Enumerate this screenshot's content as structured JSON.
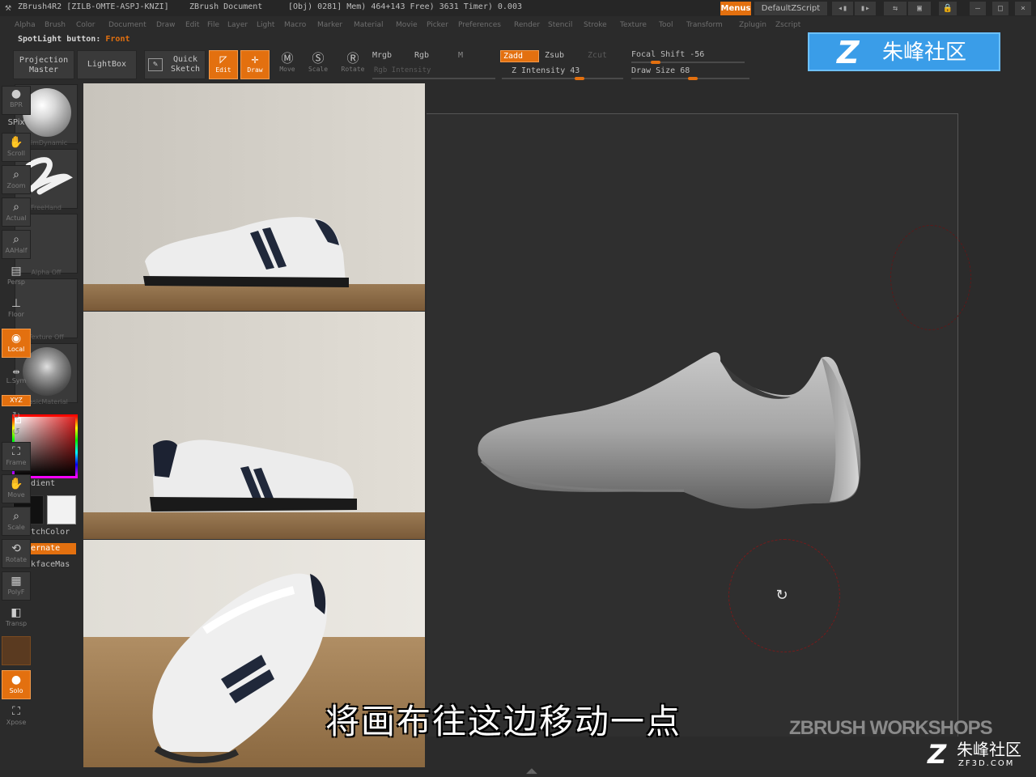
{
  "titlebar": {
    "app": "ZBrush4R2 [ZILB-OMTE-ASPJ-KNZI]",
    "document": "ZBrush Document",
    "stats": "[Obj) 0281] Mem) 464+143 Free) 3631 Timer) 0.003",
    "menus": "Menus",
    "default_zscript": "DefaultZScript"
  },
  "menubar": [
    "Alpha",
    "Brush",
    "Color",
    "Document",
    "Draw",
    "Edit",
    "File",
    "Layer",
    "Light",
    "Macro",
    "Marker",
    "Material",
    "Movie",
    "Picker",
    "Preferences",
    "Render",
    "Stencil",
    "Stroke",
    "Texture",
    "Tool",
    "Transform",
    "Zplugin",
    "Zscript"
  ],
  "spotlight": {
    "label": "SpotLight button:",
    "value": "Front"
  },
  "toolbar": {
    "projection_master": "Projection Master",
    "lightbox": "LightBox",
    "quick_sketch": "Quick Sketch",
    "edit": "Edit",
    "draw": "Draw",
    "move": "Move",
    "scale": "Scale",
    "rotate": "Rotate",
    "mrgb": "Mrgb",
    "rgb": "Rgb",
    "m": "M",
    "rgb_intensity": "Rgb Intensity",
    "zadd": "Zadd",
    "zsub": "Zsub",
    "zcut": "Zcut",
    "z_intensity": "Z Intensity 43",
    "focal_shift": "Focal Shift -56",
    "draw_size": "Draw Size 68"
  },
  "banner": {
    "logo": "Z",
    "text": "朱峰社区"
  },
  "lefttray": {
    "brush": "TrimDynamic",
    "stroke": "FreeHand",
    "alpha": "Alpha Off",
    "texture": "Texture Off",
    "material": "BasicMaterial",
    "gradient": "Gradient",
    "switchcolor": "SwitchColor",
    "alternate": "Alternate",
    "backface": "BackfaceMas"
  },
  "rightshelf": {
    "bpr": "BPR",
    "spix": "SPix",
    "scroll": "Scroll",
    "zoom": "Zoom",
    "actual": "Actual",
    "aahalf": "AAHalf",
    "persp": "Persp",
    "floor": "Floor",
    "local": "Local",
    "lsym": "L.Sym",
    "xyz": "XYZ",
    "frame": "Frame",
    "move": "Move",
    "scale": "Scale",
    "rotate": "Rotate",
    "polyf": "PolyF",
    "transp": "Transp",
    "solo": "Solo",
    "xpose": "Xpose"
  },
  "icons": {
    "zbrush_logo": "zbrush-logo-icon",
    "cursor": "rotate-cursor-icon"
  },
  "subtitle": "将画布往这边移动一点",
  "watermark": "ZBRUSH WORKSHOPS",
  "corner_logo": {
    "logo": "Z",
    "text": "朱峰社区",
    "domain": "ZF3D.COM"
  },
  "colors": {
    "accent": "#e3700f",
    "banner": "#3a9de8"
  }
}
